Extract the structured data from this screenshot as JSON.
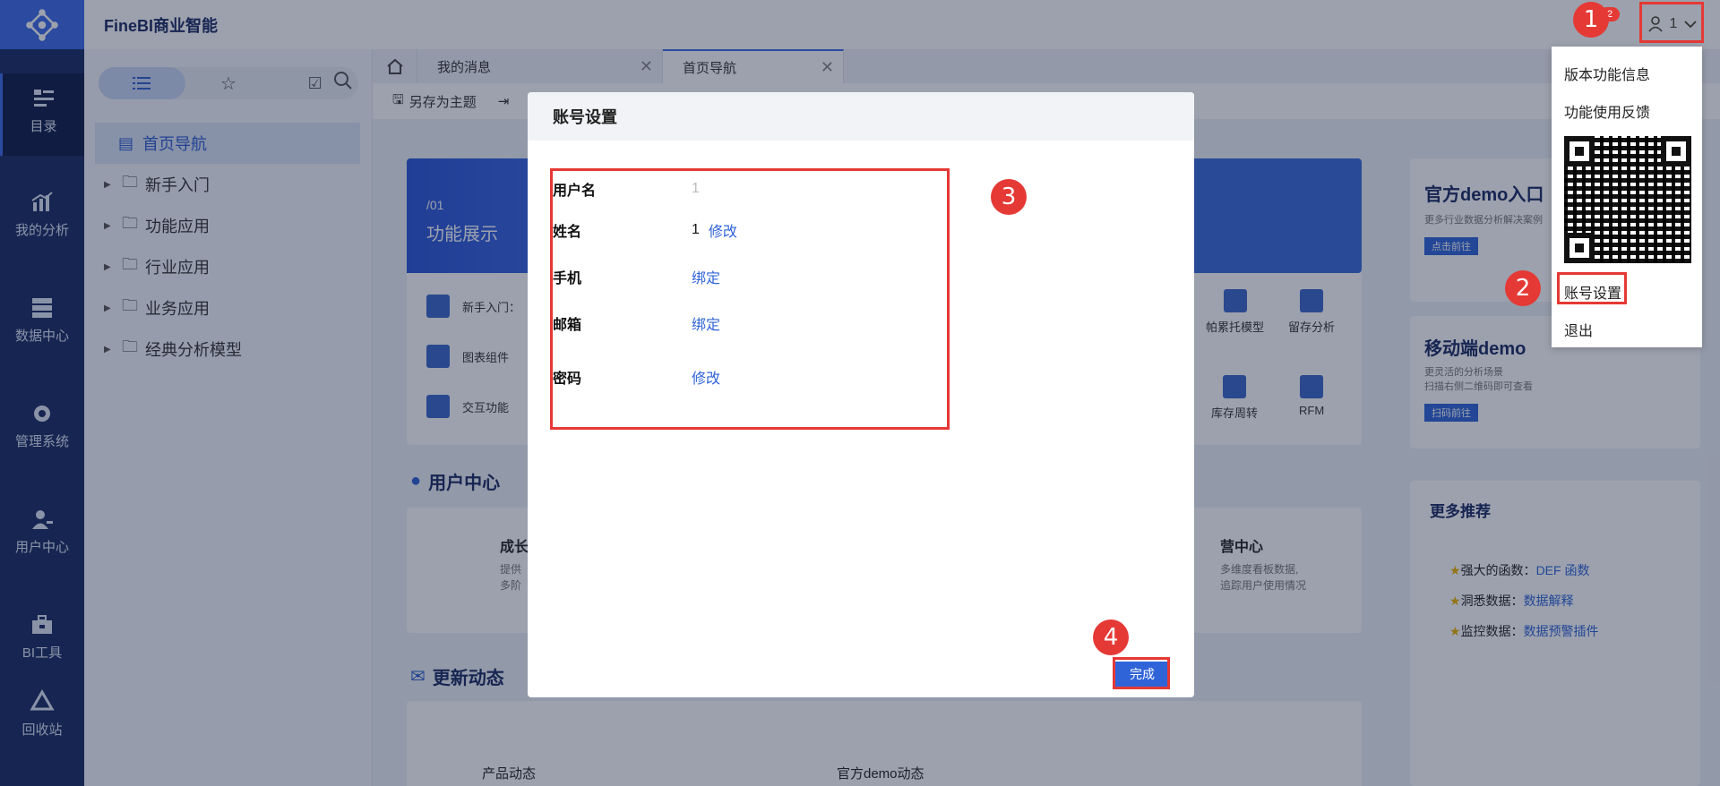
{
  "app": {
    "brand": "FineBI商业智能"
  },
  "rail": {
    "items": [
      {
        "label": "目录",
        "icon": "catalog-icon"
      },
      {
        "label": "我的分析",
        "icon": "chart-icon"
      },
      {
        "label": "数据中心",
        "icon": "database-icon"
      },
      {
        "label": "管理系统",
        "icon": "gear-icon"
      },
      {
        "label": "用户中心",
        "icon": "user-icon"
      },
      {
        "label": "BI工具",
        "icon": "toolbox-icon"
      },
      {
        "label": "回收站",
        "icon": "recycle-icon"
      }
    ]
  },
  "dirpanel": {
    "tree": [
      {
        "label": "首页导航",
        "selected": true
      },
      {
        "label": "新手入门"
      },
      {
        "label": "功能应用"
      },
      {
        "label": "行业应用"
      },
      {
        "label": "业务应用"
      },
      {
        "label": "经典分析模型"
      }
    ]
  },
  "tabs": [
    {
      "label": "我的消息"
    },
    {
      "label": "首页导航"
    }
  ],
  "toolbar": {
    "save_as_theme": "另存为主题"
  },
  "dashboard": {
    "banner_num": "/01",
    "banner_title": "功能展示",
    "mini_items": [
      "新手入门：",
      "图表组件",
      "交互功能"
    ],
    "user_center": "用户中心",
    "updates": "更新动态",
    "growth": "成长",
    "growth_desc1": "提供",
    "growth_desc2": "多阶",
    "ops_title": "营中心",
    "ops_desc1": "多维度看板数据,",
    "ops_desc2": "追踪用户使用情况",
    "models": [
      "帕累托模型",
      "留存分析",
      "库存周转",
      "RFM"
    ],
    "product_updates": "产品动态",
    "demo_updates": "官方demo动态",
    "official_demo": "官方demo入口",
    "official_demo_desc": "更多行业数据分析解决案例",
    "official_demo_btn": "点击前往",
    "mobile_demo": "移动端demo",
    "mobile_demo_desc1": "更灵活的分析场景",
    "mobile_demo_desc2": "扫描右侧二维码即可查看",
    "mobile_demo_btn": "扫码前往",
    "more": "更多推荐",
    "recs": [
      {
        "k": "强大的函数：",
        "v": "DEF 函数"
      },
      {
        "k": "洞悉数据：",
        "v": "数据解释"
      },
      {
        "k": "监控数据：",
        "v": "数据预警插件"
      }
    ]
  },
  "modal": {
    "title": "账号设置",
    "rows": [
      {
        "label": "用户名",
        "value": "1",
        "link": ""
      },
      {
        "label": "姓名",
        "value": "1",
        "link": "修改"
      },
      {
        "label": "手机",
        "value": "",
        "link": "绑定"
      },
      {
        "label": "邮箱",
        "value": "",
        "link": "绑定"
      },
      {
        "label": "密码",
        "value": "",
        "link": "修改"
      }
    ],
    "done": "完成"
  },
  "user_menu": {
    "username": "1",
    "notif_count": "2",
    "items": [
      "版本功能信息",
      "功能使用反馈",
      "账号设置",
      "退出"
    ]
  },
  "annotations": [
    "1",
    "2",
    "3",
    "4"
  ],
  "colors": {
    "accent": "#2f63d8",
    "rail": "#1b2a63",
    "highlight": "#e53935"
  }
}
